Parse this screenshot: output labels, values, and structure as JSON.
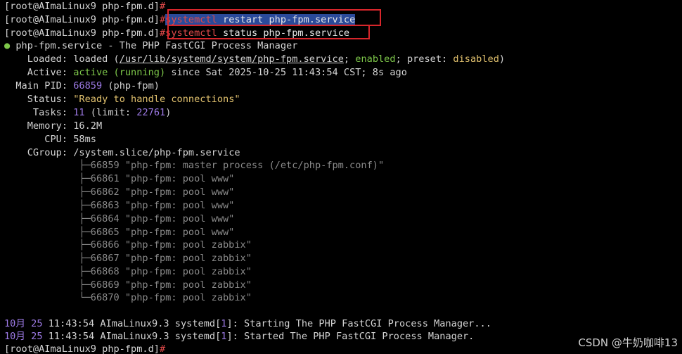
{
  "terminal": {
    "prompt": "[root@AImaLinux9 php-fpm.d]",
    "prompt_symbol": "#",
    "commands": [
      "systemctl restart php-fpm.service",
      "systemctl status php-fpm.service"
    ],
    "command_parts": {
      "restart_tool": "systemctl",
      "restart_args": " restart php-fpm.service",
      "status_tool": "systemctl",
      "status_args": " status php-fpm.service"
    }
  },
  "status": {
    "bullet": "●",
    "header": " php-fpm.service - The PHP FastCGI Process Manager",
    "loaded_label": "    Loaded: ",
    "loaded_value": "loaded (",
    "loaded_path": "/usr/lib/systemd/system/php-fpm.service",
    "loaded_sep1": "; ",
    "loaded_enabled": "enabled",
    "loaded_sep2": "; ",
    "loaded_preset_label": "preset",
    "loaded_sep3": ": ",
    "loaded_preset": "disabled",
    "loaded_close": ")",
    "active_label": "    Active: ",
    "active_value": "active (running)",
    "active_since": " since Sat 2025-10-25 11:43:54 CST; 8s ago",
    "mainpid_label": "  Main PID: ",
    "mainpid_value": "66859",
    "mainpid_name": " (php-fpm)",
    "status_label": "    Status: ",
    "status_value": "\"Ready to handle connections\"",
    "tasks_label": "     Tasks: ",
    "tasks_value": "11",
    "tasks_limit_open": " (limit: ",
    "tasks_limit": "22761",
    "tasks_limit_close": ")",
    "memory_label": "    Memory: ",
    "memory_value": "16.2M",
    "cpu_label": "       CPU: ",
    "cpu_value": "58ms",
    "cgroup_label": "    CGroup: ",
    "cgroup_value": "/system.slice/php-fpm.service"
  },
  "processes": [
    {
      "tree": "             ├─",
      "pid": "66859",
      "desc": " \"php-fpm: master process (/etc/php-fpm.conf)\""
    },
    {
      "tree": "             ├─",
      "pid": "66861",
      "desc": " \"php-fpm: pool www\""
    },
    {
      "tree": "             ├─",
      "pid": "66862",
      "desc": " \"php-fpm: pool www\""
    },
    {
      "tree": "             ├─",
      "pid": "66863",
      "desc": " \"php-fpm: pool www\""
    },
    {
      "tree": "             ├─",
      "pid": "66864",
      "desc": " \"php-fpm: pool www\""
    },
    {
      "tree": "             ├─",
      "pid": "66865",
      "desc": " \"php-fpm: pool www\""
    },
    {
      "tree": "             ├─",
      "pid": "66866",
      "desc": " \"php-fpm: pool zabbix\""
    },
    {
      "tree": "             ├─",
      "pid": "66867",
      "desc": " \"php-fpm: pool zabbix\""
    },
    {
      "tree": "             ├─",
      "pid": "66868",
      "desc": " \"php-fpm: pool zabbix\""
    },
    {
      "tree": "             ├─",
      "pid": "66869",
      "desc": " \"php-fpm: pool zabbix\""
    },
    {
      "tree": "             └─",
      "pid": "66870",
      "desc": " \"php-fpm: pool zabbix\""
    }
  ],
  "logs": [
    {
      "month": "10月",
      "day": " 25",
      "time": " 11:43:54",
      "host": " AImaLinux9.3 systemd[",
      "pid": "1",
      "rest": "]: Starting The PHP FastCGI Process Manager..."
    },
    {
      "month": "10月",
      "day": " 25",
      "time": " 11:43:54",
      "host": " AImaLinux9.3 systemd[",
      "pid": "1",
      "rest": "]: Started The PHP FastCGI Process Manager."
    }
  ],
  "watermark": "CSDN @牛奶咖啡13",
  "colors": {
    "background": "#000000",
    "selection": "#2a4a9a",
    "highlight_box": "#d7262b",
    "green": "#7ec84a",
    "purple": "#9d7ae6",
    "yellow": "#e1c16e",
    "gray": "#8a8a8a"
  }
}
